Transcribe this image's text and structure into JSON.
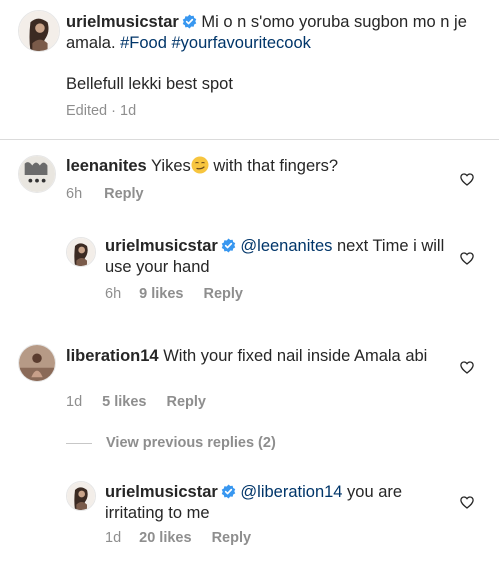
{
  "caption": {
    "username": "urielmusicstar",
    "text_before": "Mi o n s'omo yoruba sugbon mo n je amala. ",
    "hashtag1": "#Food",
    "hashtag2": "#yourfavouritecook",
    "line2": "Bellefull lekki best spot",
    "meta": "Edited · 1d"
  },
  "comments": [
    {
      "username": "leenanites",
      "text_before": "Yikes",
      "text_after": " with that fingers?",
      "time": "6h",
      "reply": "Reply",
      "avatar_icon": "user-avatar-icon",
      "heart_icon": "heart-outline-icon"
    },
    {
      "username": "urielmusicstar",
      "mention": "@leenanites",
      "text": " next Time i will use your hand",
      "time": "6h",
      "likes": "9 likes",
      "reply": "Reply"
    },
    {
      "username": "liberation14",
      "text": " With your fixed nail inside Amala abi",
      "time": "1d",
      "likes": "5 likes",
      "reply": "Reply"
    },
    {
      "username": "urielmusicstar",
      "mention": "@liberation14",
      "text": " you are irritating to me",
      "time": "1d",
      "likes": "20 likes",
      "reply": "Reply"
    }
  ],
  "view_previous": "View previous replies (2)",
  "colors": {
    "text": "#262626",
    "meta": "#8e8e8e",
    "link": "#003569",
    "verified": "#3897f0",
    "divider": "#dbdbdb"
  }
}
